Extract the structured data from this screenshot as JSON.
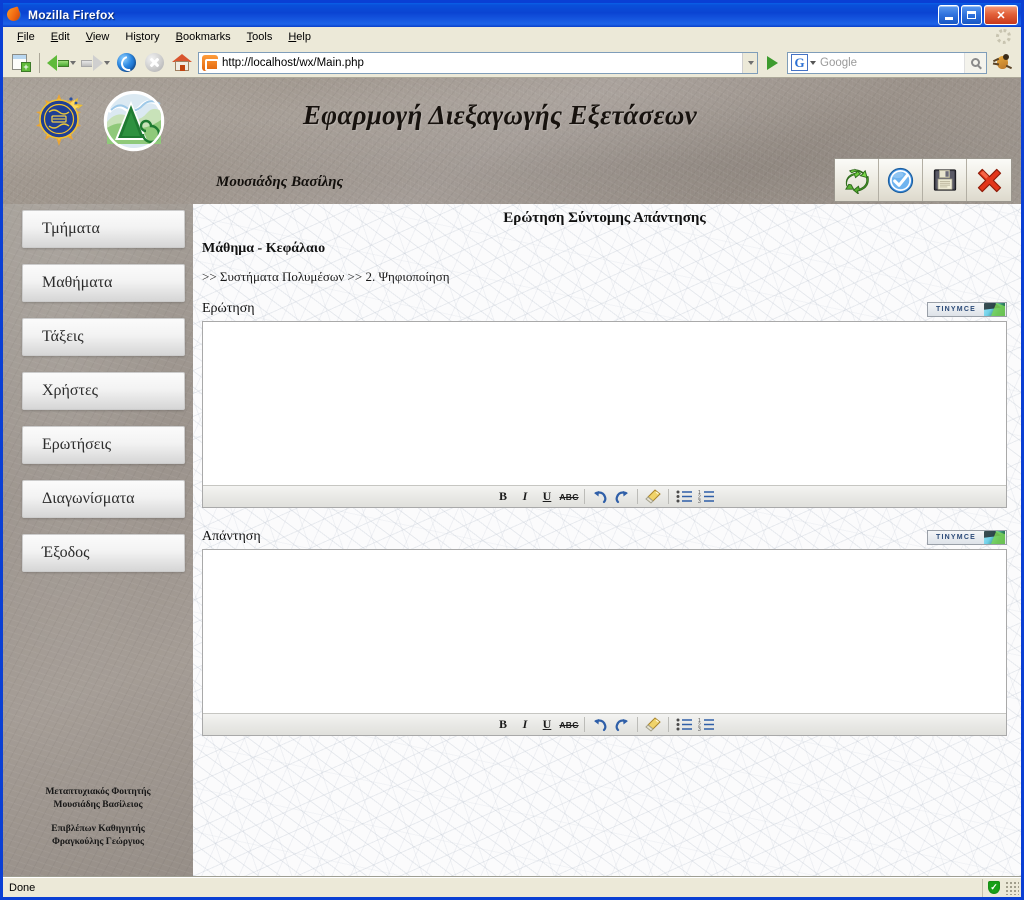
{
  "browser": {
    "window_title": "Mozilla Firefox",
    "menu": [
      {
        "label": "File",
        "accel": "F"
      },
      {
        "label": "Edit",
        "accel": "E"
      },
      {
        "label": "View",
        "accel": "V"
      },
      {
        "label": "History",
        "accel": "s"
      },
      {
        "label": "Bookmarks",
        "accel": "B"
      },
      {
        "label": "Tools",
        "accel": "T"
      },
      {
        "label": "Help",
        "accel": "H"
      }
    ],
    "toolbar": {
      "new_tab": "new-tab-icon",
      "back": "back-arrow-icon",
      "forward": "forward-arrow-icon",
      "reload": "reload-icon",
      "stop": "stop-icon",
      "home": "home-icon",
      "go": "go-icon",
      "bug": "bug-icon"
    },
    "address": {
      "url": "http://localhost/wx/Main.php",
      "favicon": "site-favicon"
    },
    "search": {
      "engine": "G",
      "placeholder": "Google",
      "value": ""
    },
    "window_controls": {
      "minimize": "minimize-button",
      "maximize": "maximize-button",
      "close": "close-button"
    },
    "status": {
      "text": "Done",
      "secure_icon": "security-shield-icon"
    }
  },
  "site": {
    "app_title": "Εφαρμογή Διεξαγωγής Εξετάσεων",
    "user_name": "Μουσιάδης Βασίλης",
    "logos": {
      "university": "university-seal-logo",
      "department": "department-emblem-logo"
    },
    "action_toolbar": [
      {
        "name": "refresh-button",
        "icon": "green-recycle-arrows-icon"
      },
      {
        "name": "confirm-button",
        "icon": "blue-check-circle-icon"
      },
      {
        "name": "save-button",
        "icon": "floppy-disk-icon"
      },
      {
        "name": "delete-button",
        "icon": "red-x-icon"
      }
    ]
  },
  "sidebar": {
    "items": [
      {
        "label": "Τμήματα",
        "name": "sidebar-item-departments"
      },
      {
        "label": "Μαθήματα",
        "name": "sidebar-item-courses"
      },
      {
        "label": "Τάξεις",
        "name": "sidebar-item-classes"
      },
      {
        "label": "Χρήστες",
        "name": "sidebar-item-users"
      },
      {
        "label": "Ερωτήσεις",
        "name": "sidebar-item-questions"
      },
      {
        "label": "Διαγωνίσματα",
        "name": "sidebar-item-exams"
      },
      {
        "label": "Έξοδος",
        "name": "sidebar-item-logout"
      }
    ],
    "footer": {
      "student_role": "Μεταπτυχιακός Φοιτητής",
      "student_name": "Μουσιάδης Βασίλειος",
      "supervisor_role": "Επιβλέπων Καθηγητής",
      "supervisor_name": "Φραγκούλης Γεώργιος"
    }
  },
  "main": {
    "page_heading": "Ερώτηση Σύντομης Απάντησης",
    "subject_label": "Μάθημα - Κεφάλαιο",
    "breadcrumb": ">> Συστήματα Πολυμέσων >> 2. Ψηφιοποίηση",
    "editors": [
      {
        "label": "Ερώτηση",
        "name": "question-editor",
        "value": "",
        "badge": "TINYMCE"
      },
      {
        "label": "Απάντηση",
        "name": "answer-editor",
        "value": "",
        "badge": "TINYMCE"
      }
    ],
    "editor_toolbar": [
      {
        "glyph": "B",
        "name": "bold-icon",
        "cls": "b"
      },
      {
        "glyph": "I",
        "name": "italic-icon",
        "cls": "i"
      },
      {
        "glyph": "U",
        "name": "underline-icon",
        "cls": "u"
      },
      {
        "glyph": "ABC",
        "name": "strikethrough-icon",
        "cls": "s"
      },
      {
        "glyph": "",
        "name": "undo-icon",
        "cls": "undo"
      },
      {
        "glyph": "",
        "name": "redo-icon",
        "cls": "redo"
      },
      {
        "glyph": "",
        "name": "cleanup-icon",
        "cls": "clean"
      },
      {
        "glyph": "",
        "name": "bullet-list-icon",
        "cls": "ul"
      },
      {
        "glyph": "",
        "name": "numbered-list-icon",
        "cls": "ol"
      }
    ]
  },
  "colors": {
    "titlebar_blue": "#0b44d2",
    "chrome_beige": "#ece9d8",
    "header_taupe": "#9d948b",
    "accent_green": "#5fba3a",
    "danger_red": "#d83a1e",
    "tinymce_blue": "#2b4a78"
  }
}
